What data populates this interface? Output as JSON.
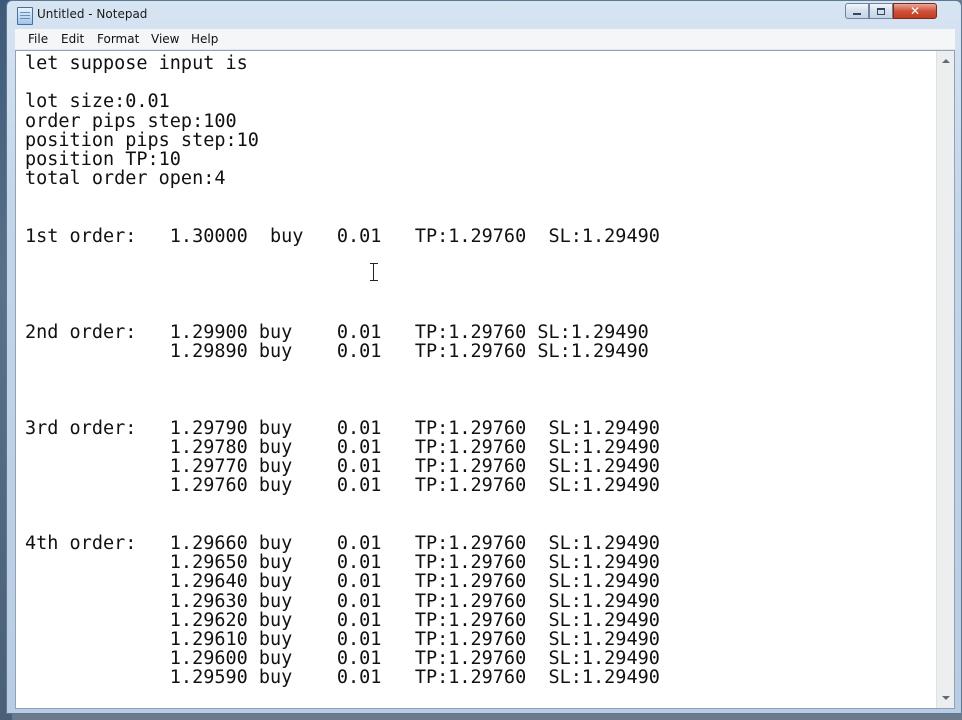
{
  "window": {
    "title": "Untitled - Notepad",
    "icon": "notepad-icon",
    "close_glyph": "✕"
  },
  "menu": [
    {
      "label": "File"
    },
    {
      "label": "Edit"
    },
    {
      "label": "Format"
    },
    {
      "label": "View"
    },
    {
      "label": "Help"
    }
  ],
  "editor": {
    "lines": [
      "let suppose input is",
      "",
      "lot size:0.01",
      "order pips step:100",
      "position pips step:10",
      "position TP:10",
      "total order open:4",
      "",
      "",
      "1st order:   1.30000  buy   0.01   TP:1.29760  SL:1.29490",
      "",
      "",
      "",
      "",
      "2nd order:   1.29900 buy    0.01   TP:1.29760 SL:1.29490",
      "             1.29890 buy    0.01   TP:1.29760 SL:1.29490",
      "",
      "",
      "",
      "3rd order:   1.29790 buy    0.01   TP:1.29760  SL:1.29490",
      "             1.29780 buy    0.01   TP:1.29760  SL:1.29490",
      "             1.29770 buy    0.01   TP:1.29760  SL:1.29490",
      "             1.29760 buy    0.01   TP:1.29760  SL:1.29490",
      "",
      "",
      "4th order:   1.29660 buy    0.01   TP:1.29760  SL:1.29490",
      "             1.29650 buy    0.01   TP:1.29760  SL:1.29490",
      "             1.29640 buy    0.01   TP:1.29760  SL:1.29490",
      "             1.29630 buy    0.01   TP:1.29760  SL:1.29490",
      "             1.29620 buy    0.01   TP:1.29760  SL:1.29490",
      "             1.29610 buy    0.01   TP:1.29760  SL:1.29490",
      "             1.29600 buy    0.01   TP:1.29760  SL:1.29490",
      "             1.29590 buy    0.01   TP:1.29760  SL:1.29490"
    ]
  }
}
